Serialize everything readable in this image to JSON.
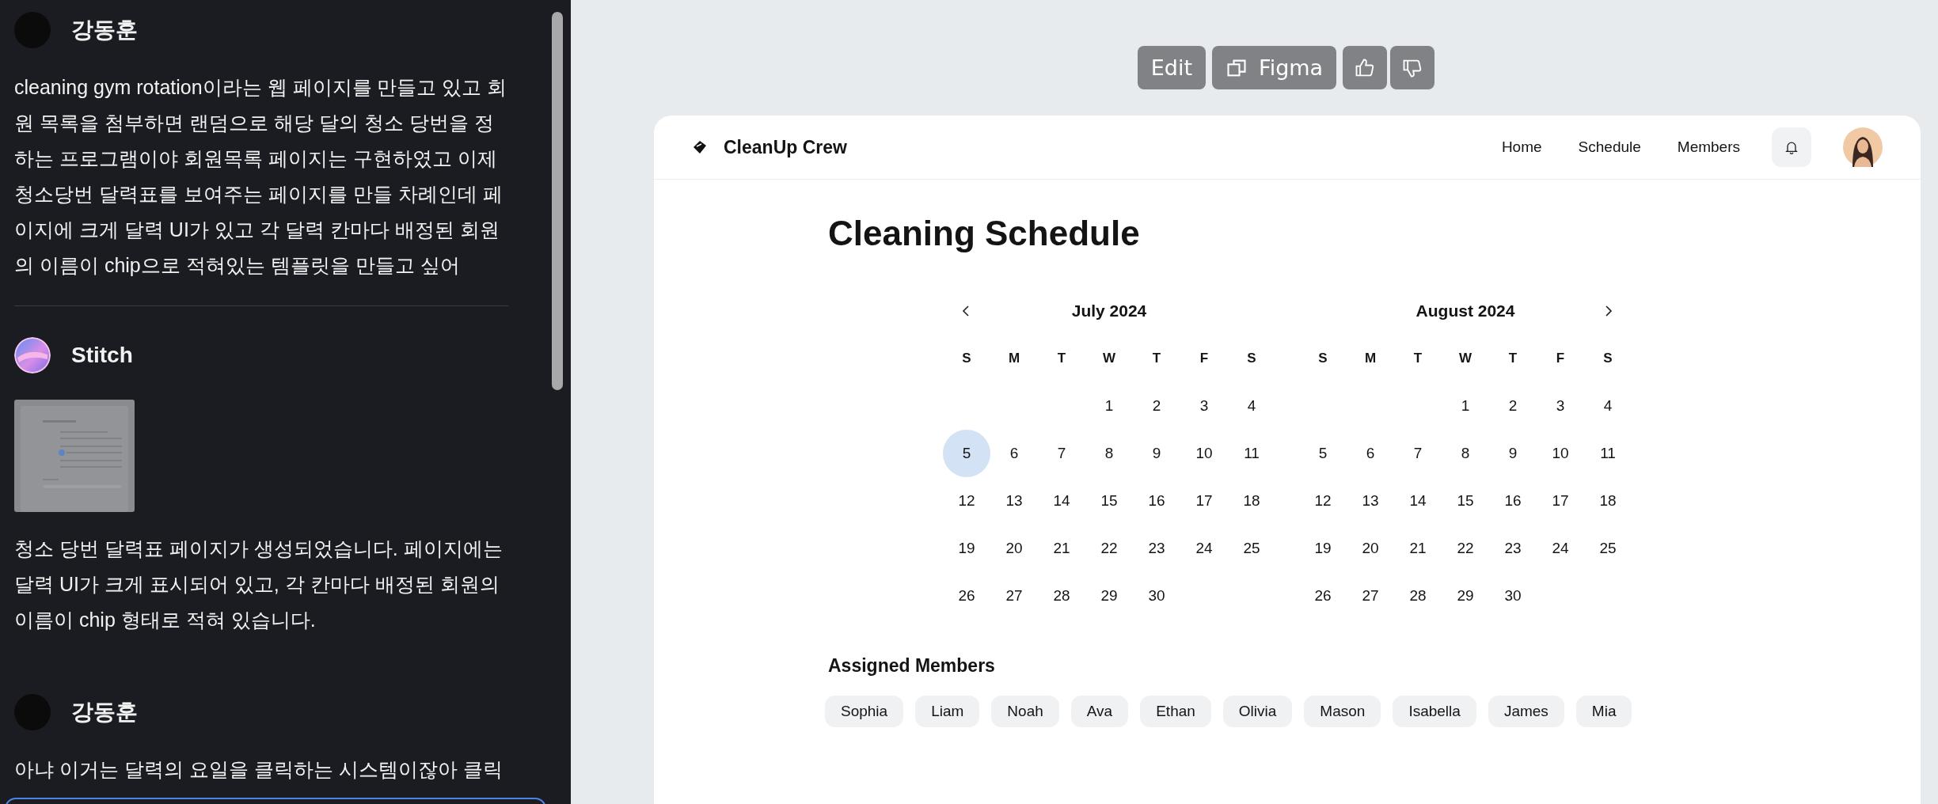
{
  "chat": {
    "messages": [
      {
        "kind": "user",
        "author": "강동훈",
        "text": "cleaning gym rotation이라는 웹 페이지를 만들고 있고 회원 목록을 첨부하면 랜덤으로 해당 달의 청소 당번을 정하는 프로그램이야 회원목록 페이지는 구현하였고 이제 청소당번 달력표를 보여주는 페이지를 만들 차례인데 페이지에 크게 달력 UI가 있고 각 달력 칸마다 배정된 회원의 이름이 chip으로 적혀있는 템플릿을 만들고 싶어"
      },
      {
        "kind": "assistant",
        "author": "Stitch",
        "text": "청소 당번 달력표 페이지가 생성되었습니다. 페이지에는 달력 UI가 크게 표시되어 있고, 각 칸마다 배정된 회원의 이름이 chip 형태로 적혀 있습니다."
      },
      {
        "kind": "user",
        "author": "강동훈",
        "text": "아냐 이거는 달력의 요일을 클릭하는 시스템이잖아 클릭"
      }
    ]
  },
  "toolbar": {
    "edit": "Edit",
    "figma": "Figma"
  },
  "app": {
    "brand": "CleanUp Crew",
    "nav": [
      "Home",
      "Schedule",
      "Members"
    ],
    "title": "Cleaning Schedule",
    "calendars": [
      {
        "month": "July 2024",
        "weekdays": [
          "S",
          "M",
          "T",
          "W",
          "T",
          "F",
          "S"
        ],
        "weeks": [
          [
            {
              "d": "1",
              "selected": false
            },
            {
              "d": "2",
              "selected": false
            },
            {
              "d": "3",
              "selected": false
            },
            {
              "d": "4",
              "selected": false
            }
          ],
          [
            {
              "d": "5",
              "selected": true
            },
            {
              "d": "6",
              "selected": false
            },
            {
              "d": "7",
              "selected": false
            },
            {
              "d": "8",
              "selected": false
            },
            {
              "d": "9",
              "selected": false
            },
            {
              "d": "10",
              "selected": false
            },
            {
              "d": "11",
              "selected": false
            }
          ],
          [
            {
              "d": "12",
              "selected": false
            },
            {
              "d": "13",
              "selected": false
            },
            {
              "d": "14",
              "selected": false
            },
            {
              "d": "15",
              "selected": false
            },
            {
              "d": "16",
              "selected": false
            },
            {
              "d": "17",
              "selected": false
            },
            {
              "d": "18",
              "selected": false
            }
          ],
          [
            {
              "d": "19",
              "selected": false
            },
            {
              "d": "20",
              "selected": false
            },
            {
              "d": "21",
              "selected": false
            },
            {
              "d": "22",
              "selected": false
            },
            {
              "d": "23",
              "selected": false
            },
            {
              "d": "24",
              "selected": false
            },
            {
              "d": "25",
              "selected": false
            }
          ],
          [
            {
              "d": "26",
              "selected": false
            },
            {
              "d": "27",
              "selected": false
            },
            {
              "d": "28",
              "selected": false
            },
            {
              "d": "29",
              "selected": false
            },
            {
              "d": "30",
              "selected": false
            }
          ]
        ]
      },
      {
        "month": "August 2024",
        "weekdays": [
          "S",
          "M",
          "T",
          "W",
          "T",
          "F",
          "S"
        ],
        "weeks": [
          [
            {
              "d": "1",
              "selected": false
            },
            {
              "d": "2",
              "selected": false
            },
            {
              "d": "3",
              "selected": false
            },
            {
              "d": "4",
              "selected": false
            }
          ],
          [
            {
              "d": "5",
              "selected": false
            },
            {
              "d": "6",
              "selected": false
            },
            {
              "d": "7",
              "selected": false
            },
            {
              "d": "8",
              "selected": false
            },
            {
              "d": "9",
              "selected": false
            },
            {
              "d": "10",
              "selected": false
            },
            {
              "d": "11",
              "selected": false
            }
          ],
          [
            {
              "d": "12",
              "selected": false
            },
            {
              "d": "13",
              "selected": false
            },
            {
              "d": "14",
              "selected": false
            },
            {
              "d": "15",
              "selected": false
            },
            {
              "d": "16",
              "selected": false
            },
            {
              "d": "17",
              "selected": false
            },
            {
              "d": "18",
              "selected": false
            }
          ],
          [
            {
              "d": "19",
              "selected": false
            },
            {
              "d": "20",
              "selected": false
            },
            {
              "d": "21",
              "selected": false
            },
            {
              "d": "22",
              "selected": false
            },
            {
              "d": "23",
              "selected": false
            },
            {
              "d": "24",
              "selected": false
            },
            {
              "d": "25",
              "selected": false
            }
          ],
          [
            {
              "d": "26",
              "selected": false
            },
            {
              "d": "27",
              "selected": false
            },
            {
              "d": "28",
              "selected": false
            },
            {
              "d": "29",
              "selected": false
            },
            {
              "d": "30",
              "selected": false
            }
          ]
        ]
      }
    ],
    "members_heading": "Assigned Members",
    "members": [
      "Sophia",
      "Liam",
      "Noah",
      "Ava",
      "Ethan",
      "Olivia",
      "Mason",
      "Isabella",
      "James",
      "Mia"
    ]
  }
}
